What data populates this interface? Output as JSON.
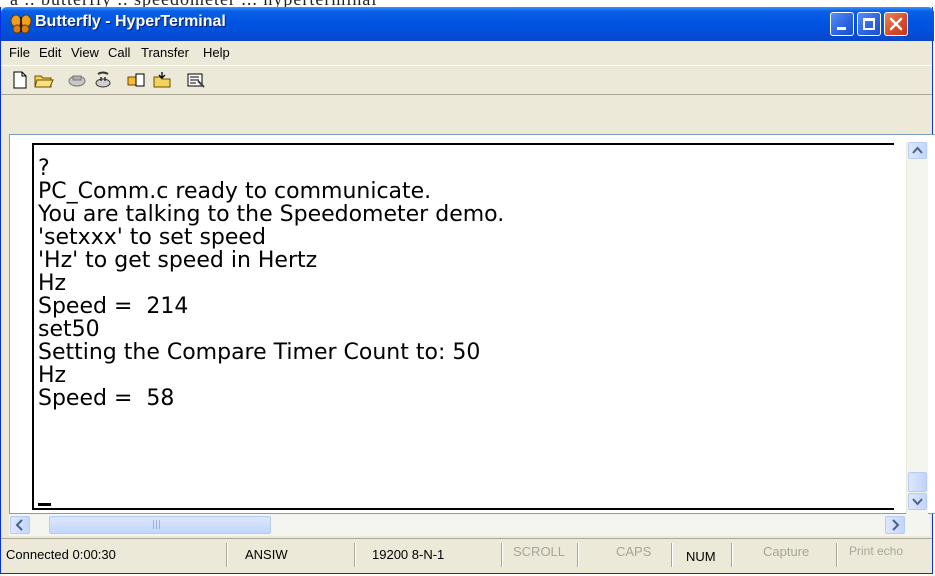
{
  "caption_fragment": "a .. butterfly  .. speedometer  ... hyperterminal",
  "window": {
    "title": "Butterfly - HyperTerminal",
    "icon": "butterfly-icon"
  },
  "menu": [
    "File",
    "Edit",
    "View",
    "Call",
    "Transfer",
    "Help"
  ],
  "toolbar": [
    {
      "name": "new-icon"
    },
    {
      "name": "open-folder-icon"
    },
    {
      "name": "call-icon"
    },
    {
      "name": "disconnect-icon"
    },
    {
      "name": "send-icon"
    },
    {
      "name": "receive-icon"
    },
    {
      "name": "properties-icon"
    }
  ],
  "terminal": {
    "lines": [
      "?",
      "PC_Comm.c ready to communicate.",
      "You are talking to the Speedometer demo.",
      "'setxxx' to set speed",
      "'Hz' to get speed in Hertz",
      "Hz",
      "Speed =  214",
      "set50",
      "Setting the Compare Timer Count to: 50",
      "Hz",
      "Speed =  58"
    ]
  },
  "hscroll_thumb_grip": "|||",
  "status": {
    "connected": "Connected 0:00:30",
    "emulation": "ANSIW",
    "settings": "19200 8-N-1",
    "scroll": "SCROLL",
    "caps": "CAPS",
    "num": "NUM",
    "capture": "Capture",
    "print_echo": "Print echo"
  },
  "colors": {
    "titlebar": "#0054e3",
    "close_button": "#d9492a",
    "chrome": "#ece9d8"
  }
}
